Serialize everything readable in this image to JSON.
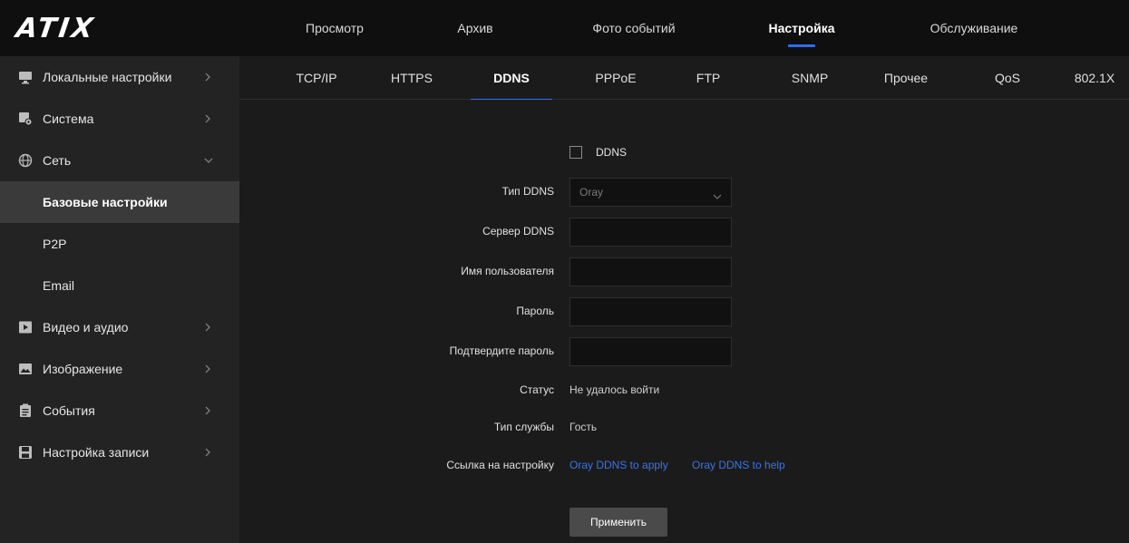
{
  "brand": {
    "logo": "ATIX"
  },
  "topnav": {
    "items": [
      {
        "label": "Просмотр"
      },
      {
        "label": "Архив"
      },
      {
        "label": "Фото событий"
      },
      {
        "label": "Настройка"
      },
      {
        "label": "Обслуживание"
      }
    ],
    "active": "Настройка"
  },
  "sidebar": {
    "items": [
      {
        "label": "Локальные настройки",
        "icon": "monitor-icon"
      },
      {
        "label": "Система",
        "icon": "system-settings-icon"
      },
      {
        "label": "Сеть",
        "icon": "network-globe-icon"
      },
      {
        "label": "Видео и аудио",
        "icon": "video-play-icon"
      },
      {
        "label": "Изображение",
        "icon": "image-icon"
      },
      {
        "label": "События",
        "icon": "clipboard-icon"
      },
      {
        "label": "Настройка записи",
        "icon": "floppy-disk-icon"
      }
    ],
    "subitems": [
      {
        "label": "Базовые настройки"
      },
      {
        "label": "P2P"
      },
      {
        "label": "Email"
      }
    ],
    "active_sub": "Базовые настройки"
  },
  "tabs": {
    "items": [
      {
        "label": "TCP/IP"
      },
      {
        "label": "HTTPS"
      },
      {
        "label": "DDNS"
      },
      {
        "label": "PPPoE"
      },
      {
        "label": "FTP"
      },
      {
        "label": "SNMP"
      },
      {
        "label": "Прочее"
      },
      {
        "label": "QoS"
      },
      {
        "label": "802.1X"
      }
    ],
    "active": "DDNS"
  },
  "form": {
    "enable_label": "DDNS",
    "enable_checked": false,
    "type_label": "Тип DDNS",
    "type_value": "Oray",
    "server_label": "Сервер DDNS",
    "server_value": "",
    "username_label": "Имя пользователя",
    "username_value": "",
    "password_label": "Пароль",
    "password_value": "",
    "confirm_label": "Подтвердите пароль",
    "confirm_value": "",
    "status_label": "Статус",
    "status_value": "Не удалось войти",
    "service_label": "Тип службы",
    "service_value": "Гость",
    "link_label": "Ссылка на настройку",
    "link_apply": "Oray DDNS to apply",
    "link_help": "Oray DDNS to help",
    "apply_button": "Применить"
  },
  "colors": {
    "accent": "#2f6df0",
    "link": "#3a74e8",
    "background": "#1b1b1b",
    "sidebar": "#232323",
    "header": "#0f0f0f"
  }
}
